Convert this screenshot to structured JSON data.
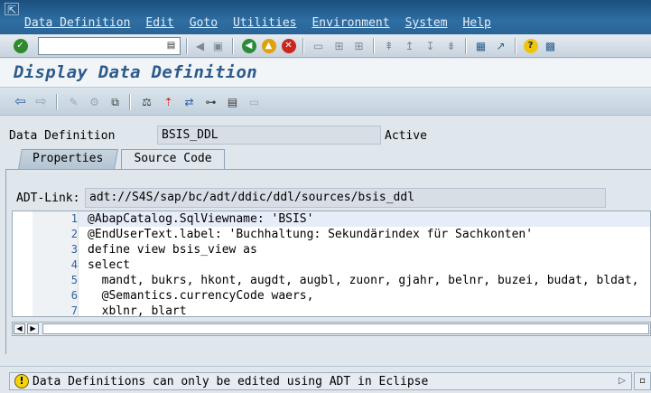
{
  "menubar": {
    "items": [
      "Data Definition",
      "Edit",
      "Goto",
      "Utilities",
      "Environment",
      "System",
      "Help"
    ]
  },
  "toolbar": {
    "command_value": "",
    "icons": [
      "enter-icon",
      "save-icon",
      "back-icon",
      "exit-icon",
      "cancel-icon",
      "print-icon",
      "find-icon",
      "find-next-icon",
      "first-page-icon",
      "previous-page-icon",
      "next-page-icon",
      "last-page-icon",
      "create-session-icon",
      "shortcut-icon",
      "help-icon",
      "layout-icon"
    ]
  },
  "title": "Display Data Definition",
  "app_toolbar": {
    "icons": [
      "arrow-left-icon",
      "arrow-right-icon",
      "edit-icon",
      "display-change-icon",
      "other-object-icon",
      "check-icon",
      "activate-icon",
      "where-used-icon",
      "object-list-icon",
      "navigation-window-icon",
      "fullscreen-icon"
    ]
  },
  "header": {
    "label": "Data Definition",
    "value": "BSIS_DDL",
    "status": "Active"
  },
  "tabs": [
    {
      "label": "Properties",
      "active": false
    },
    {
      "label": "Source Code",
      "active": true
    }
  ],
  "adt": {
    "label": "ADT-Link:",
    "value": "adt://S4S/sap/bc/adt/ddic/ddl/sources/bsis_ddl"
  },
  "editor": {
    "lines": [
      {
        "no": "1",
        "text": "@AbapCatalog.SqlViewname: 'BSIS'"
      },
      {
        "no": "2",
        "text": "@EndUserText.label: 'Buchhaltung: Sekundärindex für Sachkonten'"
      },
      {
        "no": "3",
        "text": "define view bsis_view as"
      },
      {
        "no": "4",
        "text": "select"
      },
      {
        "no": "5",
        "text": "  mandt, bukrs, hkont, augdt, augbl, zuonr, gjahr, belnr, buzei, budat, bldat,"
      },
      {
        "no": "6",
        "text": "  @Semantics.currencyCode waers,"
      },
      {
        "no": "7",
        "text": "  xblnr, blart"
      }
    ]
  },
  "status": {
    "message": "Data Definitions can only be edited using ADT in Eclipse",
    "type": "warning"
  },
  "colors": {
    "menubar": "#2a6496",
    "title": "#2d5b8c",
    "line_numbers": "#2f5fa0",
    "warning": "#f5d20e"
  }
}
